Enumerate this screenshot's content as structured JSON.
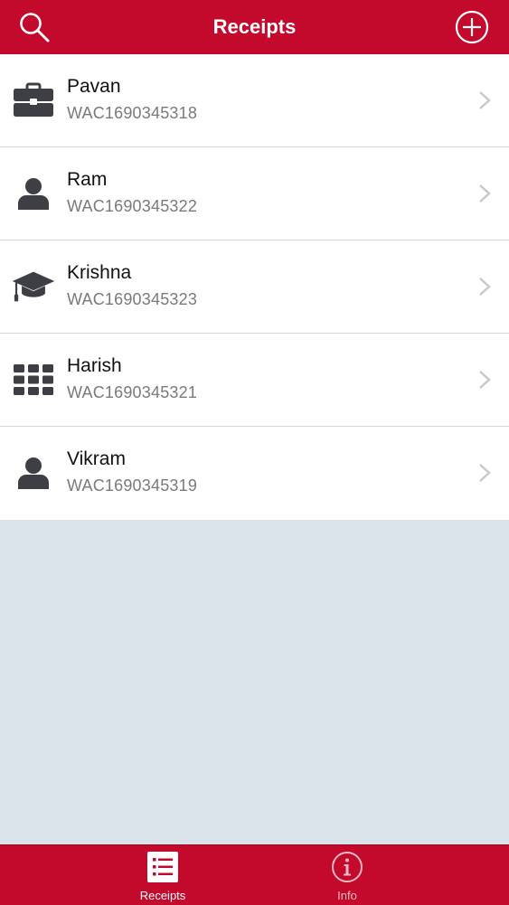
{
  "header": {
    "title": "Receipts",
    "search_icon": "search-icon",
    "add_icon": "add-circle-icon",
    "bar_color": "#c40a2c"
  },
  "receipts": [
    {
      "name": "Pavan",
      "id": "WAC1690345318",
      "icon": "briefcase-icon"
    },
    {
      "name": "Ram",
      "id": "WAC1690345322",
      "icon": "person-icon"
    },
    {
      "name": "Krishna",
      "id": "WAC1690345323",
      "icon": "graduation-cap-icon"
    },
    {
      "name": "Harish",
      "id": "WAC1690345321",
      "icon": "grid-icon"
    },
    {
      "name": "Vikram",
      "id": "WAC1690345319",
      "icon": "person-icon"
    }
  ],
  "tab_bar": {
    "tabs": [
      {
        "label": "Receipts",
        "icon": "list-icon",
        "selected": true
      },
      {
        "label": "Info",
        "icon": "info-icon",
        "selected": false
      }
    ]
  },
  "colors": {
    "accent": "#c40a2c",
    "background": "#dbe3ea",
    "icon": "#3d3f44",
    "secondary_text": "#7a7a7a"
  }
}
